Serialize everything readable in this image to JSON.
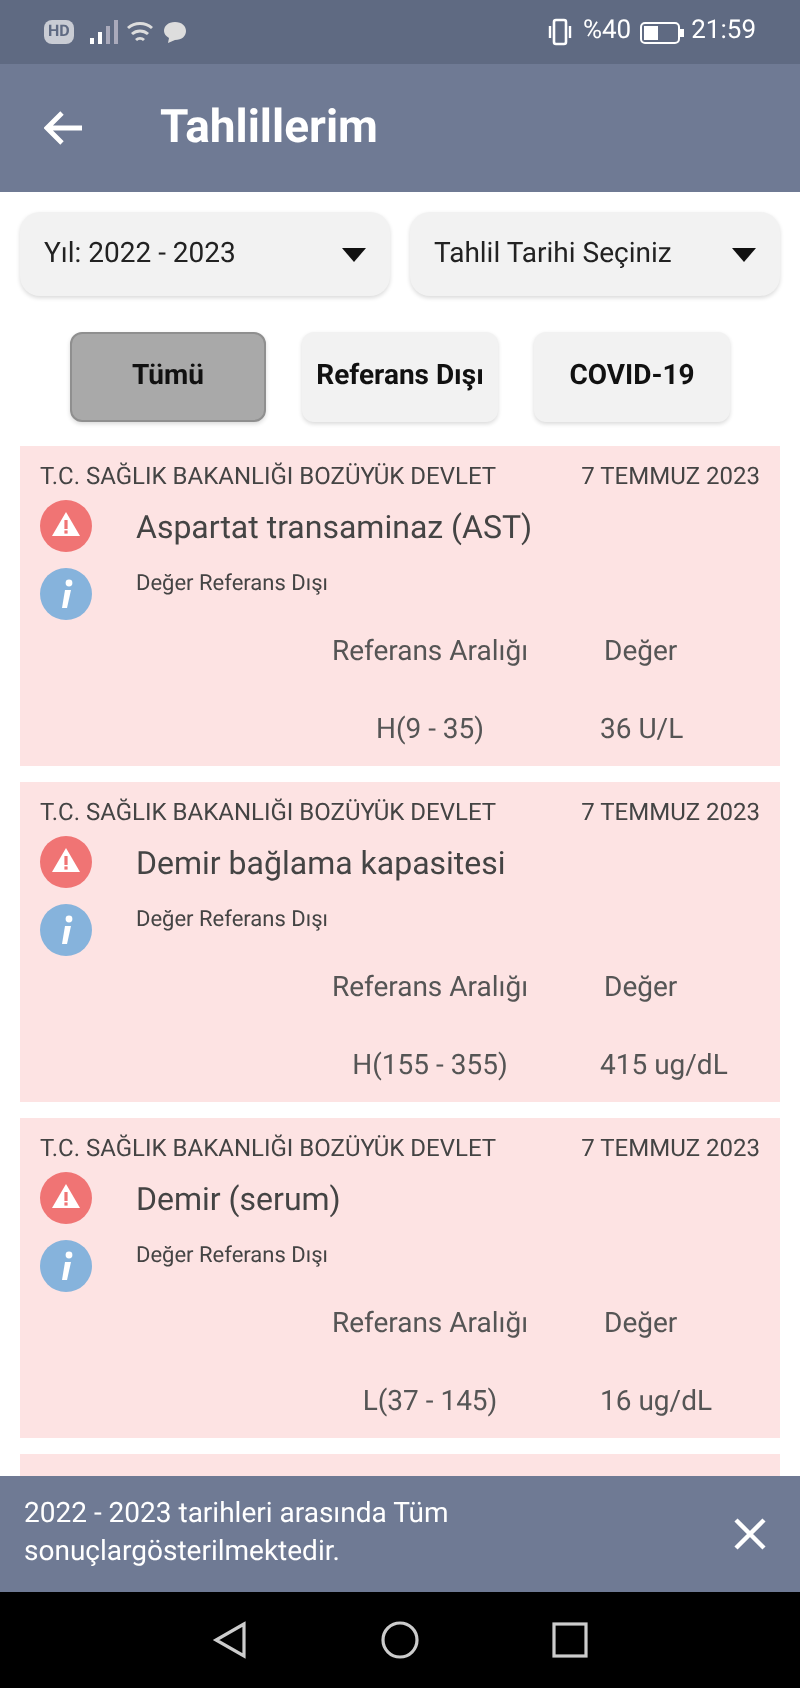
{
  "status_bar": {
    "network": "HD",
    "battery": "%40",
    "time": "21:59"
  },
  "header": {
    "title": "Tahlillerim"
  },
  "filters": [
    {
      "label": "Yıl: 2022 - 2023"
    },
    {
      "label": "Tahlil Tarihi Seçiniz"
    }
  ],
  "tabs": [
    {
      "label": "Tümü",
      "selected": true
    },
    {
      "label": "Referans Dışı",
      "selected": false
    },
    {
      "label": "COVID-19",
      "selected": false
    }
  ],
  "results": [
    {
      "hospital": "T.C. SAĞLIK BAKANLIĞI BOZÜYÜK DEVLET",
      "date": "7 TEMMUZ 2023",
      "name": "Aspartat transaminaz (AST)",
      "status": "Değer Referans Dışı",
      "range_label": "Referans Aralığı",
      "value_label": "Değer",
      "range": "H(9 - 35)",
      "value": "36 U/L"
    },
    {
      "hospital": "T.C. SAĞLIK BAKANLIĞI BOZÜYÜK DEVLET",
      "date": "7 TEMMUZ 2023",
      "name": "Demir bağlama kapasitesi",
      "status": "Değer Referans Dışı",
      "range_label": "Referans Aralığı",
      "value_label": "Değer",
      "range": "H(155 - 355)",
      "value": "415 ug/dL"
    },
    {
      "hospital": "T.C. SAĞLIK BAKANLIĞI BOZÜYÜK DEVLET",
      "date": "7 TEMMUZ 2023",
      "name": "Demir (serum)",
      "status": "Değer Referans Dışı",
      "range_label": "Referans Aralığı",
      "value_label": "Değer",
      "range": "L(37 - 145)",
      "value": "16 ug/dL"
    }
  ],
  "snackbar": {
    "message": "2022 - 2023 tarihleri arasında Tüm sonuçlargösterilmektedir."
  }
}
